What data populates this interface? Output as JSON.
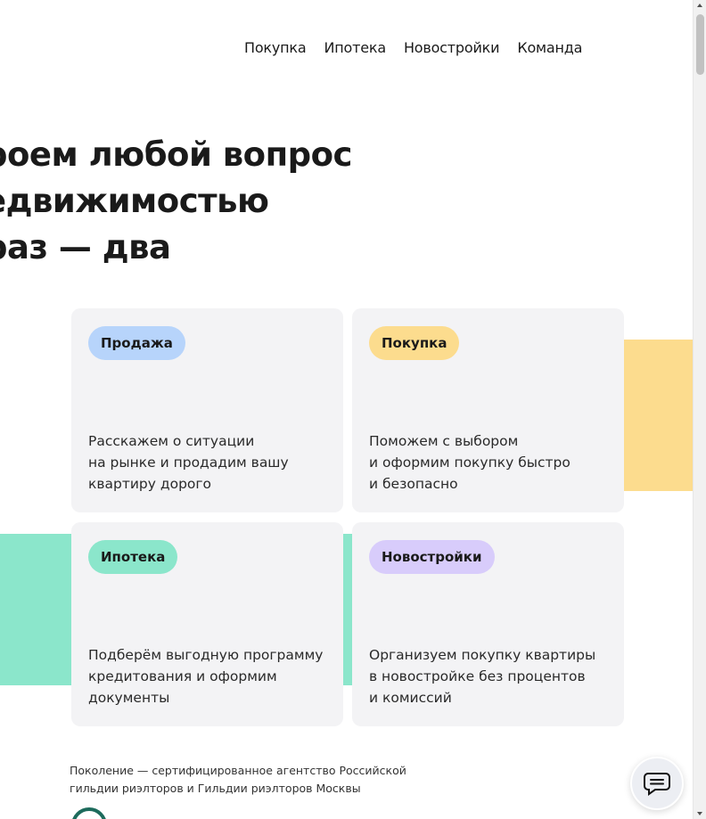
{
  "nav": {
    "items": [
      {
        "label": "Покупка"
      },
      {
        "label": "Ипотека"
      },
      {
        "label": "Новостройки"
      },
      {
        "label": "Команда"
      }
    ]
  },
  "hero": {
    "line1": "роем любой вопрос",
    "line2": "едвижимостью",
    "line3": "раз — два"
  },
  "cards": [
    {
      "badge": "Продажа",
      "badge_color": "#b7d4fb",
      "desc": "Расскажем о ситуации\nна рынке и продадим вашу\nквартиру дорого"
    },
    {
      "badge": "Покупка",
      "badge_color": "#fcdc8e",
      "desc": "Поможем с выбором\nи оформим покупку быстро\nи безопасно"
    },
    {
      "badge": "Ипотека",
      "badge_color": "#8be6cb",
      "desc": "Подберём выгодную программу\nкредитования и оформим\nдокументы"
    },
    {
      "badge": "Новостройки",
      "badge_color": "#d8ccfb",
      "desc": "Организуем покупку квартиры\nв новостройке без процентов\nи комиссий"
    }
  ],
  "colors": {
    "deco_yellow": "#fcdc8e",
    "deco_green": "#8be6cb",
    "card_bg": "#f3f3f5"
  },
  "footnote": "Поколение — сертифицированное агентство Российской\nгильдии риэлторов и Гильдии риэлторов Москвы",
  "chat": {
    "icon": "chat-bubble-icon"
  }
}
